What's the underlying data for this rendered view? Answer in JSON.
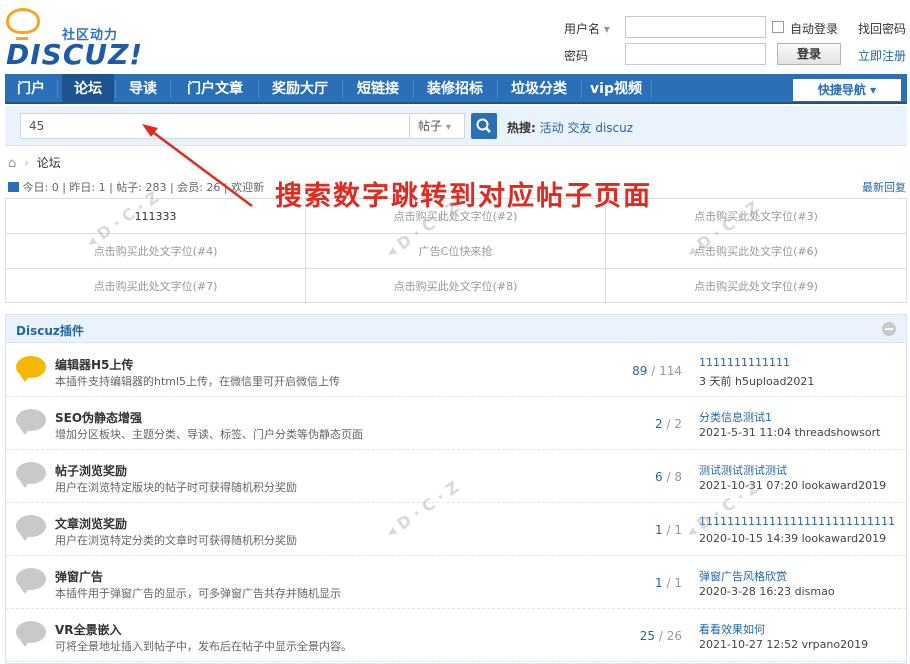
{
  "header": {
    "logo_slogan": "社区动力",
    "logo_word": "DISCUZ!",
    "username_label": "用户名",
    "password_label": "密码",
    "remember_label": "自动登录",
    "forgot_label": "找回密码",
    "login_label": "登录",
    "register_label": "立即注册"
  },
  "nav": {
    "items": [
      "门户",
      "论坛",
      "导读",
      "门户文章",
      "奖励大厅",
      "短链接",
      "装修招标",
      "垃圾分类",
      "vip视频"
    ],
    "active": "论坛",
    "quicknav": "快捷导航"
  },
  "search": {
    "value": "45",
    "type": "帖子",
    "hot_label": "热搜:",
    "hot_items": [
      "活动",
      "交友",
      "discuz"
    ]
  },
  "breadcrumb": {
    "current": "论坛"
  },
  "stats": {
    "text": "今日: 0 | 昨日: 1 | 帖子: 283 | 会员: 26 | 欢迎新",
    "latest": "最新回复"
  },
  "annotation": "搜索数字跳转到对应帖子页面",
  "ads": [
    "111333",
    "点击购买此处文字位(#2)",
    "点击购买此处文字位(#3)",
    "点击购买此处文字位(#4)",
    "广告C位快来抢",
    "点击购买此处文字位(#6)",
    "点击购买此处文字位(#7)",
    "点击购买此处文字位(#8)",
    "点击购买此处文字位(#9)"
  ],
  "section": {
    "title": "Discuz插件",
    "plugins": [
      {
        "name": "编辑器H5上传",
        "desc": "本插件支持编辑器的html5上传，在微信里可开启微信上传",
        "threads": "89",
        "posts": "114",
        "last_title": "1111111111111",
        "last_meta": "3 天前 h5upload2021",
        "new": true
      },
      {
        "name": "SEO伪静态增强",
        "desc": "增加分区板块、主题分类、导读、标签、门户分类等伪静态页面",
        "threads": "2",
        "posts": "2",
        "last_title": "分类信息测试1",
        "last_meta": "2021-5-31 11:04 threadshowsort",
        "new": false
      },
      {
        "name": "帖子浏览奖励",
        "desc": "用户在浏览特定版块的帖子时可获得随机积分奖励",
        "threads": "6",
        "posts": "8",
        "last_title": "测试测试测试测试",
        "last_meta": "2021-10-31 07:20 lookaward2019",
        "new": false
      },
      {
        "name": "文章浏览奖励",
        "desc": "用户在浏览特定分类的文章时可获得随机积分奖励",
        "threads": "1",
        "posts": "1",
        "last_title": "1111111111111111111111111111",
        "last_meta": "2020-10-15 14:39 lookaward2019",
        "new": false
      },
      {
        "name": "弹窗广告",
        "desc": "本插件用于弹窗广告的显示，可多弹窗广告共存并随机显示",
        "threads": "1",
        "posts": "1",
        "last_title": "弹窗广告风格欣赏",
        "last_meta": "2020-3-28 16:23 dismao",
        "new": false
      },
      {
        "name": "VR全景嵌入",
        "desc": "可将全景地址插入到帖子中，发布后在帖子中显示全景内容。",
        "threads": "25",
        "posts": "26",
        "last_title": "看看效果如何",
        "last_meta": "2021-10-27 12:52 vrpano2019",
        "new": false
      }
    ]
  },
  "colors": {
    "nav": "#2b6fb7",
    "annotation": "#e02b20",
    "link": "#2366a8"
  }
}
